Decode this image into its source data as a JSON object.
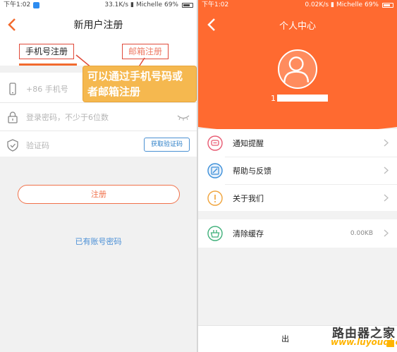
{
  "left": {
    "status": {
      "time": "下午1:02",
      "speed": "33.1K/s",
      "carrier": "Michelle",
      "battery": "69%"
    },
    "title": "新用户注册",
    "tabs": {
      "phone": "手机号注册",
      "email": "邮箱注册"
    },
    "annotation": "可以通过手机号码或者邮箱注册",
    "fields": {
      "phone_placeholder": "+86 手机号",
      "password_placeholder": "登录密码，不少于6位数",
      "code_placeholder": "验证码",
      "get_code_button": "获取验证码"
    },
    "register_button": "注册",
    "login_link": "已有账号密码"
  },
  "right": {
    "status": {
      "time": "下午1:02",
      "speed": "0.02K/s",
      "carrier": "Michelle",
      "battery": "69%"
    },
    "title": "个人中心",
    "username_prefix": "1",
    "menu": [
      {
        "label": "通知提醒",
        "icon": "chat-bubble-icon",
        "color": "#e85a72"
      },
      {
        "label": "帮助与反馈",
        "icon": "edit-icon",
        "color": "#3b8fd9"
      },
      {
        "label": "关于我们",
        "icon": "info-icon",
        "color": "#f0a33a"
      }
    ],
    "cache": {
      "label": "清除缓存",
      "value": "0.00KB",
      "icon": "basket-icon",
      "color": "#3fb07a"
    },
    "logout": "出",
    "watermark": "路由器之家",
    "watermark_sub": "www.luyouqi.com"
  },
  "colors": {
    "accent": "#ff6a30",
    "link": "#4a8fd6",
    "annotation": "#f5b84f"
  }
}
